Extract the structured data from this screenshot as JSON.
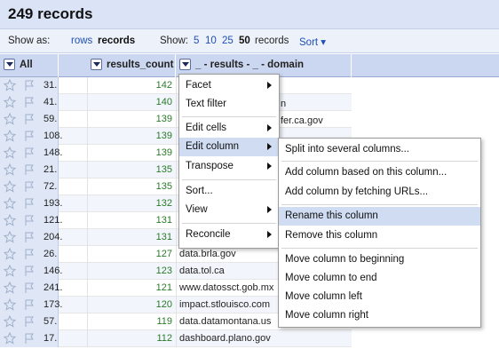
{
  "header": {
    "record_count": "249 records"
  },
  "show_bar": {
    "show_as_label": "Show as:",
    "rows_link": "rows",
    "records_label": "records",
    "show_label": "Show:",
    "page_sizes": [
      "5",
      "10",
      "25"
    ],
    "page_size_selected": "50",
    "page_size_suffix": "records",
    "sort_label": "Sort ▾"
  },
  "columns": {
    "all": "All",
    "results_count": "results_count",
    "domain": "_ - results - _ - domain"
  },
  "rows": [
    {
      "num": "31.",
      "count": "142",
      "domain": ""
    },
    {
      "num": "41.",
      "count": "140",
      "domain": ""
    },
    {
      "num": "59.",
      "count": "139",
      "domain": ""
    },
    {
      "num": "108.",
      "count": "139",
      "domain": ""
    },
    {
      "num": "148.",
      "count": "139",
      "domain": ""
    },
    {
      "num": "21.",
      "count": "135",
      "domain": ""
    },
    {
      "num": "72.",
      "count": "135",
      "domain": ""
    },
    {
      "num": "193.",
      "count": "132",
      "domain": ""
    },
    {
      "num": "121.",
      "count": "131",
      "domain": ""
    },
    {
      "num": "204.",
      "count": "131",
      "domain": ""
    },
    {
      "num": "26.",
      "count": "127",
      "domain": "data.brla.gov"
    },
    {
      "num": "146.",
      "count": "123",
      "domain": "data.tol.ca"
    },
    {
      "num": "241.",
      "count": "121",
      "domain": "www.datossct.gob.mx"
    },
    {
      "num": "173.",
      "count": "120",
      "domain": "impact.stlouisco.com"
    },
    {
      "num": "57.",
      "count": "119",
      "domain": "data.datamontana.us"
    },
    {
      "num": "17.",
      "count": "112",
      "domain": "dashboard.plano.gov"
    }
  ],
  "peek": {
    "row2": "n",
    "row3": "fer.ca.gov"
  },
  "column_menu": {
    "items": [
      "Facet",
      "Text filter",
      "Edit cells",
      "Edit column",
      "Transpose",
      "Sort...",
      "View",
      "Reconcile"
    ]
  },
  "edit_column_submenu": {
    "items": [
      "Split into several columns...",
      "Add column based on this column...",
      "Add column by fetching URLs...",
      "Rename this column",
      "Remove this column",
      "Move column to beginning",
      "Move column to end",
      "Move column left",
      "Move column right"
    ]
  }
}
